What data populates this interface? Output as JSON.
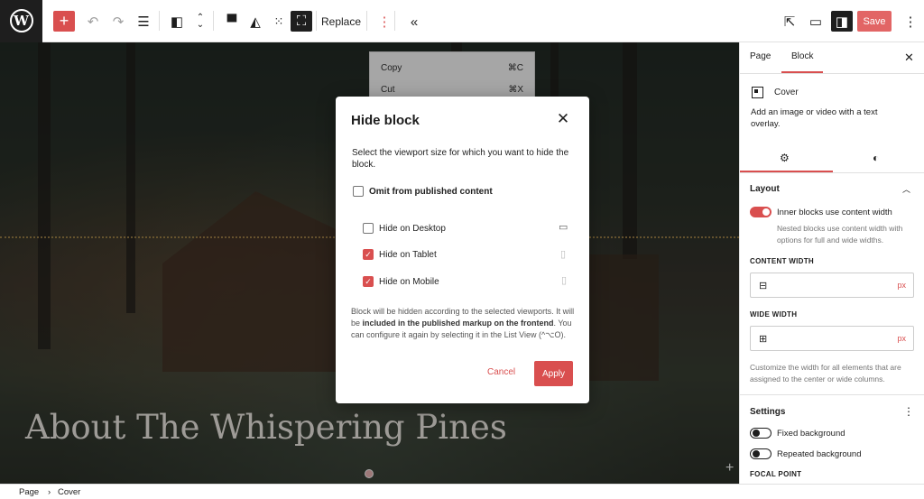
{
  "toolbar": {
    "logo_letter": "W",
    "add_label": "+",
    "undo_icon": "undo-icon",
    "redo_icon": "redo-icon",
    "list_view_icon": "list-view-icon",
    "replace_label": "Replace",
    "more_label": "⋮",
    "collapse_label": "«",
    "save_label": "Save"
  },
  "canvas": {
    "cover_title": "About The Whispering Pines",
    "add_block_label": "+"
  },
  "context_menu": {
    "items": [
      {
        "label": "Copy",
        "shortcut": "⌘C"
      },
      {
        "label": "Cut",
        "shortcut": "⌘X"
      }
    ]
  },
  "modal": {
    "title": "Hide block",
    "close_label": "✕",
    "description": "Select the viewport size for which you want to hide the block.",
    "omit_label": "Omit from published content",
    "omit_checked": false,
    "options": [
      {
        "label": "Hide on Desktop",
        "checked": false,
        "icon": "desktop-icon"
      },
      {
        "label": "Hide on Tablet",
        "checked": true,
        "icon": "tablet-icon"
      },
      {
        "label": "Hide on Mobile",
        "checked": true,
        "icon": "mobile-icon"
      }
    ],
    "note_before": "Block will be hidden according to the selected viewports. It will be ",
    "note_bold": "included in the published markup on the frontend",
    "note_after": ". You can configure it again by selecting it in the List View (^⌥O).",
    "cancel_label": "Cancel",
    "apply_label": "Apply"
  },
  "sidebar": {
    "tabs": [
      "Page",
      "Block"
    ],
    "active_tab": "Block",
    "close_label": "✕",
    "block_name": "Cover",
    "block_description": "Add an image or video with a text overlay.",
    "sub_tabs": [
      "settings-icon",
      "styles-icon"
    ],
    "layout": {
      "title": "Layout",
      "toggle_label": "Inner blocks use content width",
      "toggle_on": true,
      "toggle_help": "Nested blocks use content width with options for full and wide widths.",
      "content_width_label": "CONTENT WIDTH",
      "wide_width_label": "WIDE WIDTH",
      "unit": "px",
      "help": "Customize the width for all elements that are assigned to the center or wide columns."
    },
    "settings": {
      "title": "Settings",
      "fixed_bg_label": "Fixed background",
      "repeated_bg_label": "Repeated background",
      "focal_point_label": "FOCAL POINT"
    }
  },
  "footer": {
    "crumbs": [
      "Page",
      "Cover"
    ],
    "separator": "›"
  },
  "colors": {
    "accent": "#d94f4f",
    "dark": "#1e1e1e"
  }
}
